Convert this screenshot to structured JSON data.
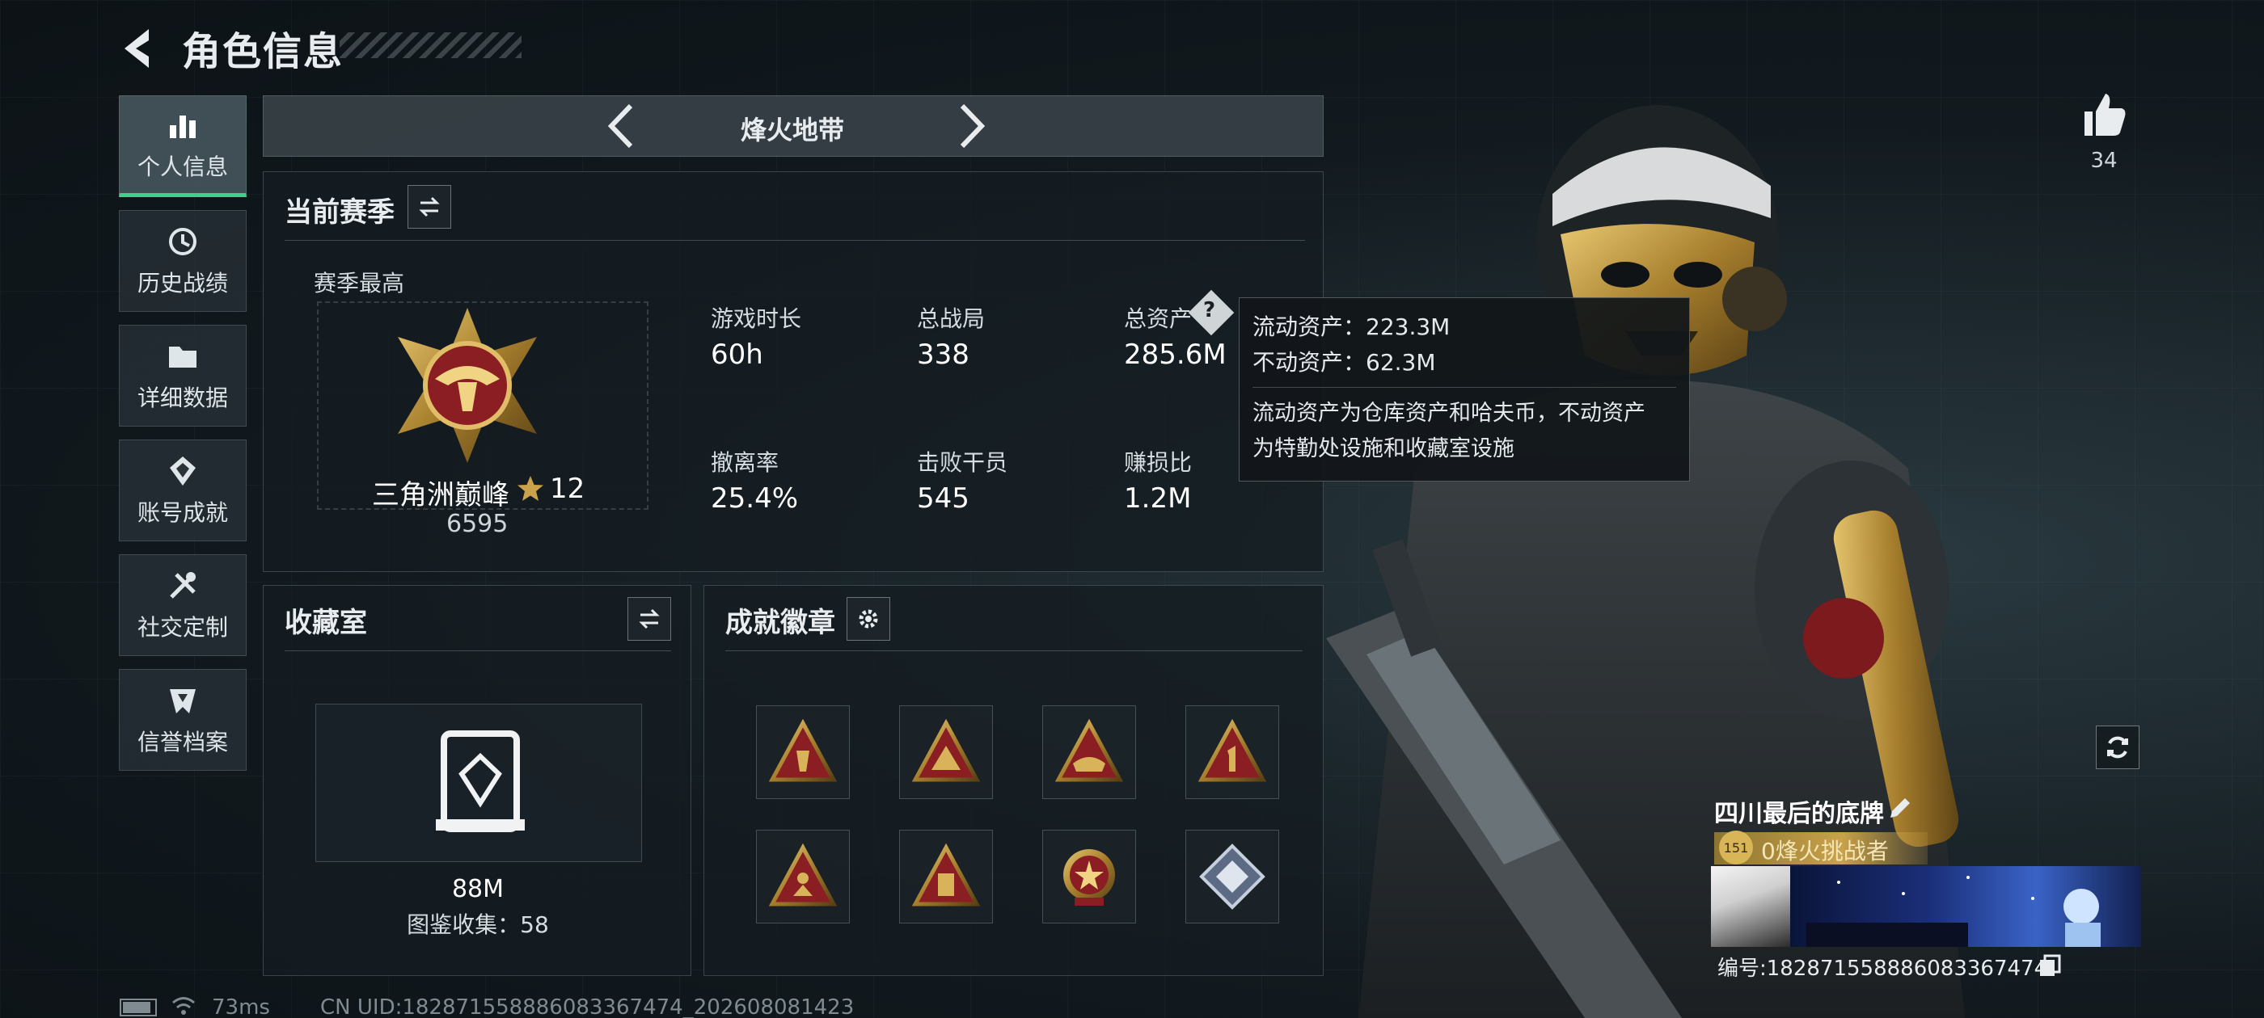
{
  "header": {
    "title": "角色信息"
  },
  "sidebar": {
    "items": [
      {
        "label": "个人信息",
        "icon": "bar-chart-icon"
      },
      {
        "label": "历史战绩",
        "icon": "history-icon"
      },
      {
        "label": "详细数据",
        "icon": "folder-icon"
      },
      {
        "label": "账号成就",
        "icon": "achievement-icon"
      },
      {
        "label": "社交定制",
        "icon": "tools-icon"
      },
      {
        "label": "信誉档案",
        "icon": "shield-icon"
      }
    ]
  },
  "mode": {
    "title": "烽火地带"
  },
  "season": {
    "title": "当前赛季",
    "best_label": "赛季最高",
    "rank_name": "三角洲巅峰",
    "rank_stars": "12",
    "rank_score": "6595",
    "stats": [
      {
        "label": "游戏时长",
        "value": "60h"
      },
      {
        "label": "总战局",
        "value": "338"
      },
      {
        "label": "总资产",
        "value": "285.6M"
      },
      {
        "label": "撤离率",
        "value": "25.4%"
      },
      {
        "label": "击败干员",
        "value": "545"
      },
      {
        "label": "赚损比",
        "value": "1.2M"
      }
    ]
  },
  "tooltip": {
    "liquid": "流动资产：223.3M",
    "fixed": "不动资产：62.3M",
    "note_line1": "流动资产为仓库资产和哈夫币，不动资产",
    "note_line2": "为特勤处设施和收藏室设施"
  },
  "collection": {
    "title": "收藏室",
    "value": "88M",
    "catalog": "图鉴收集：58"
  },
  "badges": {
    "title": "成就徽章"
  },
  "likes": {
    "count": "34"
  },
  "profile": {
    "name": "四川最后的底牌",
    "level": "151",
    "title_badge": "0烽火挑战者",
    "id_text": "编号:182871558886083367474"
  },
  "footer": {
    "ping": "73ms",
    "uid": "CN UID:182871558886083367474_202608081423"
  },
  "colors": {
    "accent_green": "#3fd18b",
    "gold": "#c9a24a",
    "badge_red": "#8a1e22"
  }
}
